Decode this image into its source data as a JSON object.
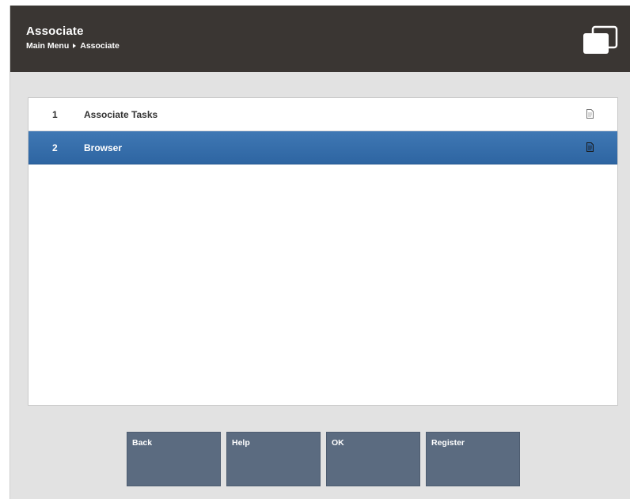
{
  "header": {
    "title": "Associate",
    "breadcrumb": [
      "Main Menu",
      "Associate"
    ],
    "icon": "windows-icon"
  },
  "menu": {
    "items": [
      {
        "number": "1",
        "label": "Associate Tasks",
        "icon": "document-icon",
        "selected": false
      },
      {
        "number": "2",
        "label": "Browser",
        "icon": "document-icon",
        "selected": true
      }
    ]
  },
  "buttons": {
    "back": "Back",
    "help": "Help",
    "ok": "OK",
    "register": "Register"
  },
  "colors": {
    "header_bg": "#3a3633",
    "selected_row": "#3a72b0",
    "button_bg": "#5b6b80",
    "window_bg": "#e2e2e2"
  }
}
